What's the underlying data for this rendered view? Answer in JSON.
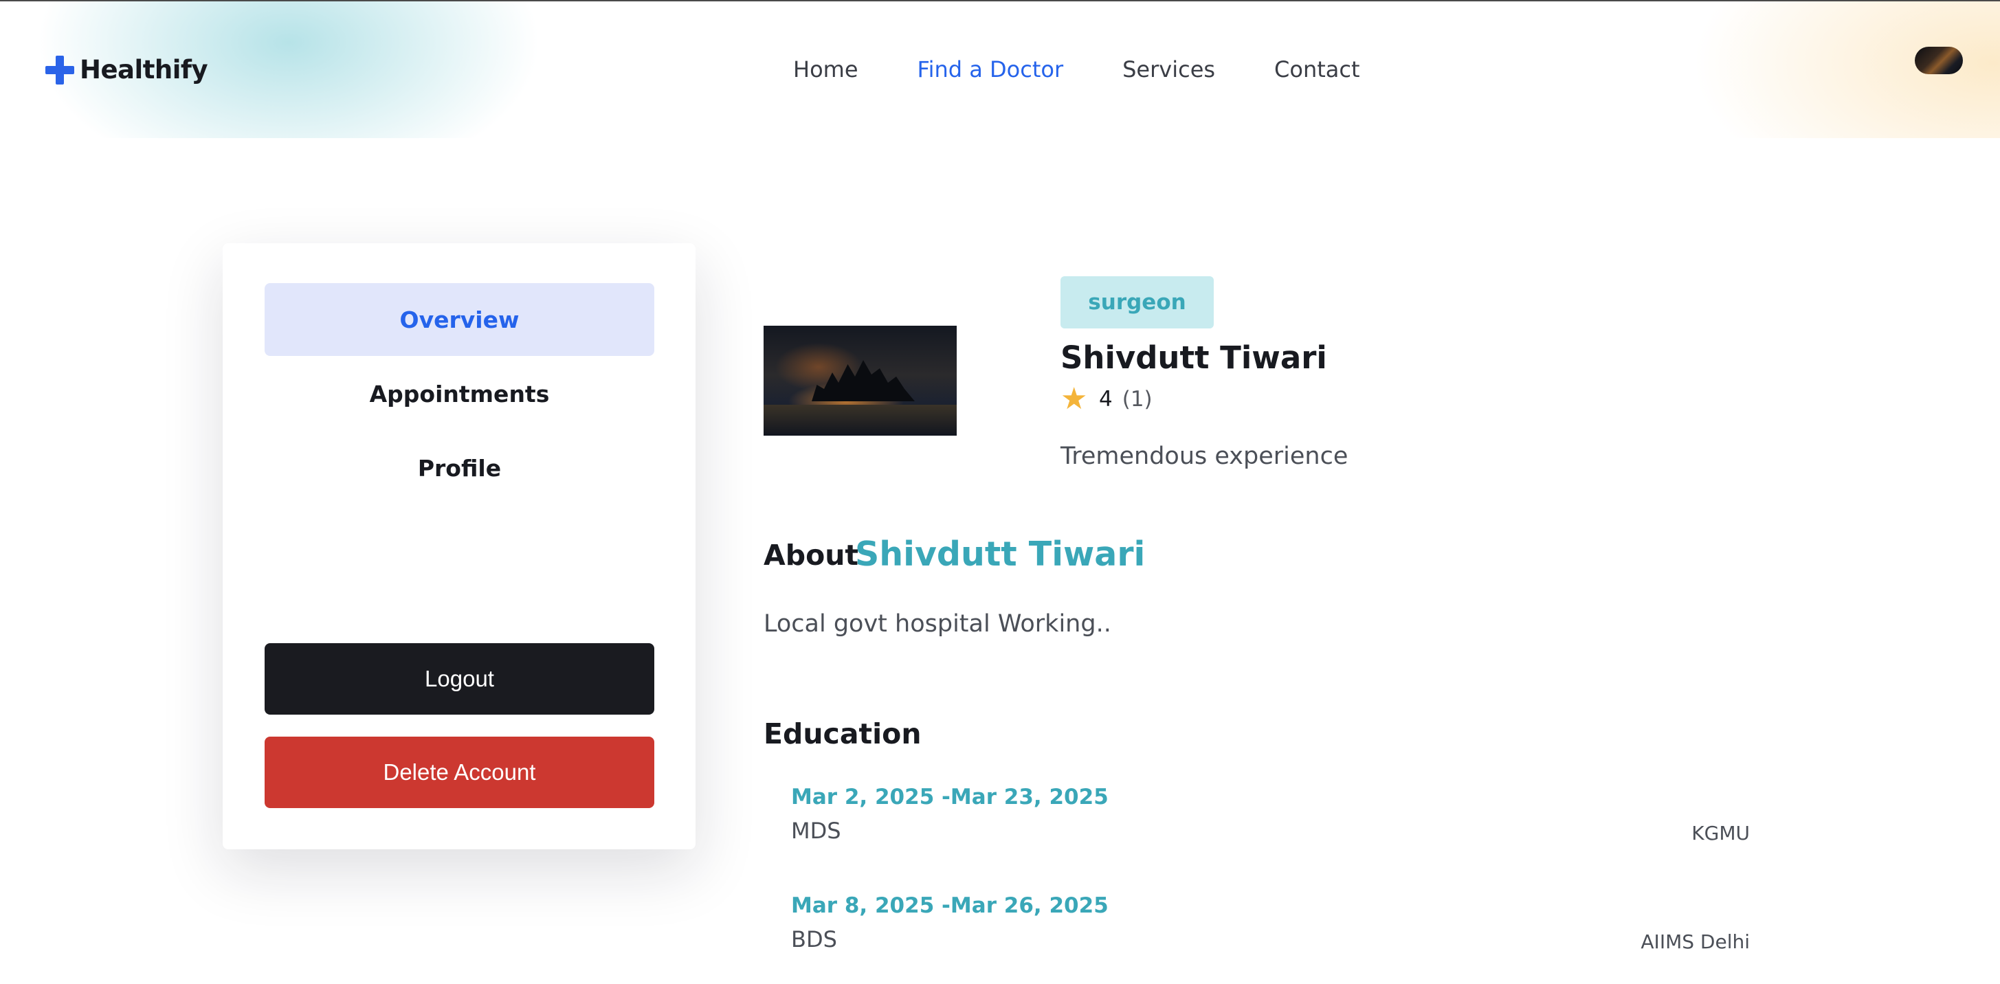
{
  "brand": {
    "name": "Healthify",
    "icon": "plus-icon",
    "color": "#2a63e8"
  },
  "nav": {
    "items": [
      {
        "label": "Home",
        "active": false
      },
      {
        "label": "Find a Doctor",
        "active": true
      },
      {
        "label": "Services",
        "active": false
      },
      {
        "label": "Contact",
        "active": false
      }
    ]
  },
  "sidebar": {
    "tabs": [
      {
        "label": "Overview",
        "active": true
      },
      {
        "label": "Appointments",
        "active": false
      },
      {
        "label": "Profile",
        "active": false
      }
    ],
    "logout_label": "Logout",
    "delete_label": "Delete Account"
  },
  "doctor": {
    "specialty": "surgeon",
    "name": "Shivdutt Tiwari",
    "rating": "4",
    "rating_count": "(1)",
    "short_bio": "Tremendous experience"
  },
  "about": {
    "label": "About",
    "name": "Shivdutt Tiwari",
    "text": "Local govt hospital Working.."
  },
  "education": {
    "title": "Education",
    "items": [
      {
        "dates": "Mar 2, 2025 -Mar 23, 2025",
        "degree": "MDS",
        "school": "KGMU"
      },
      {
        "dates": "Mar 8, 2025 -Mar 26, 2025",
        "degree": "BDS",
        "school": "AIIMS Delhi"
      }
    ]
  },
  "colors": {
    "accent_blue": "#2563eb",
    "teal": "#3aa7b8",
    "danger": "#cc3830",
    "dark": "#1a1b20",
    "star": "#f4b43a"
  }
}
